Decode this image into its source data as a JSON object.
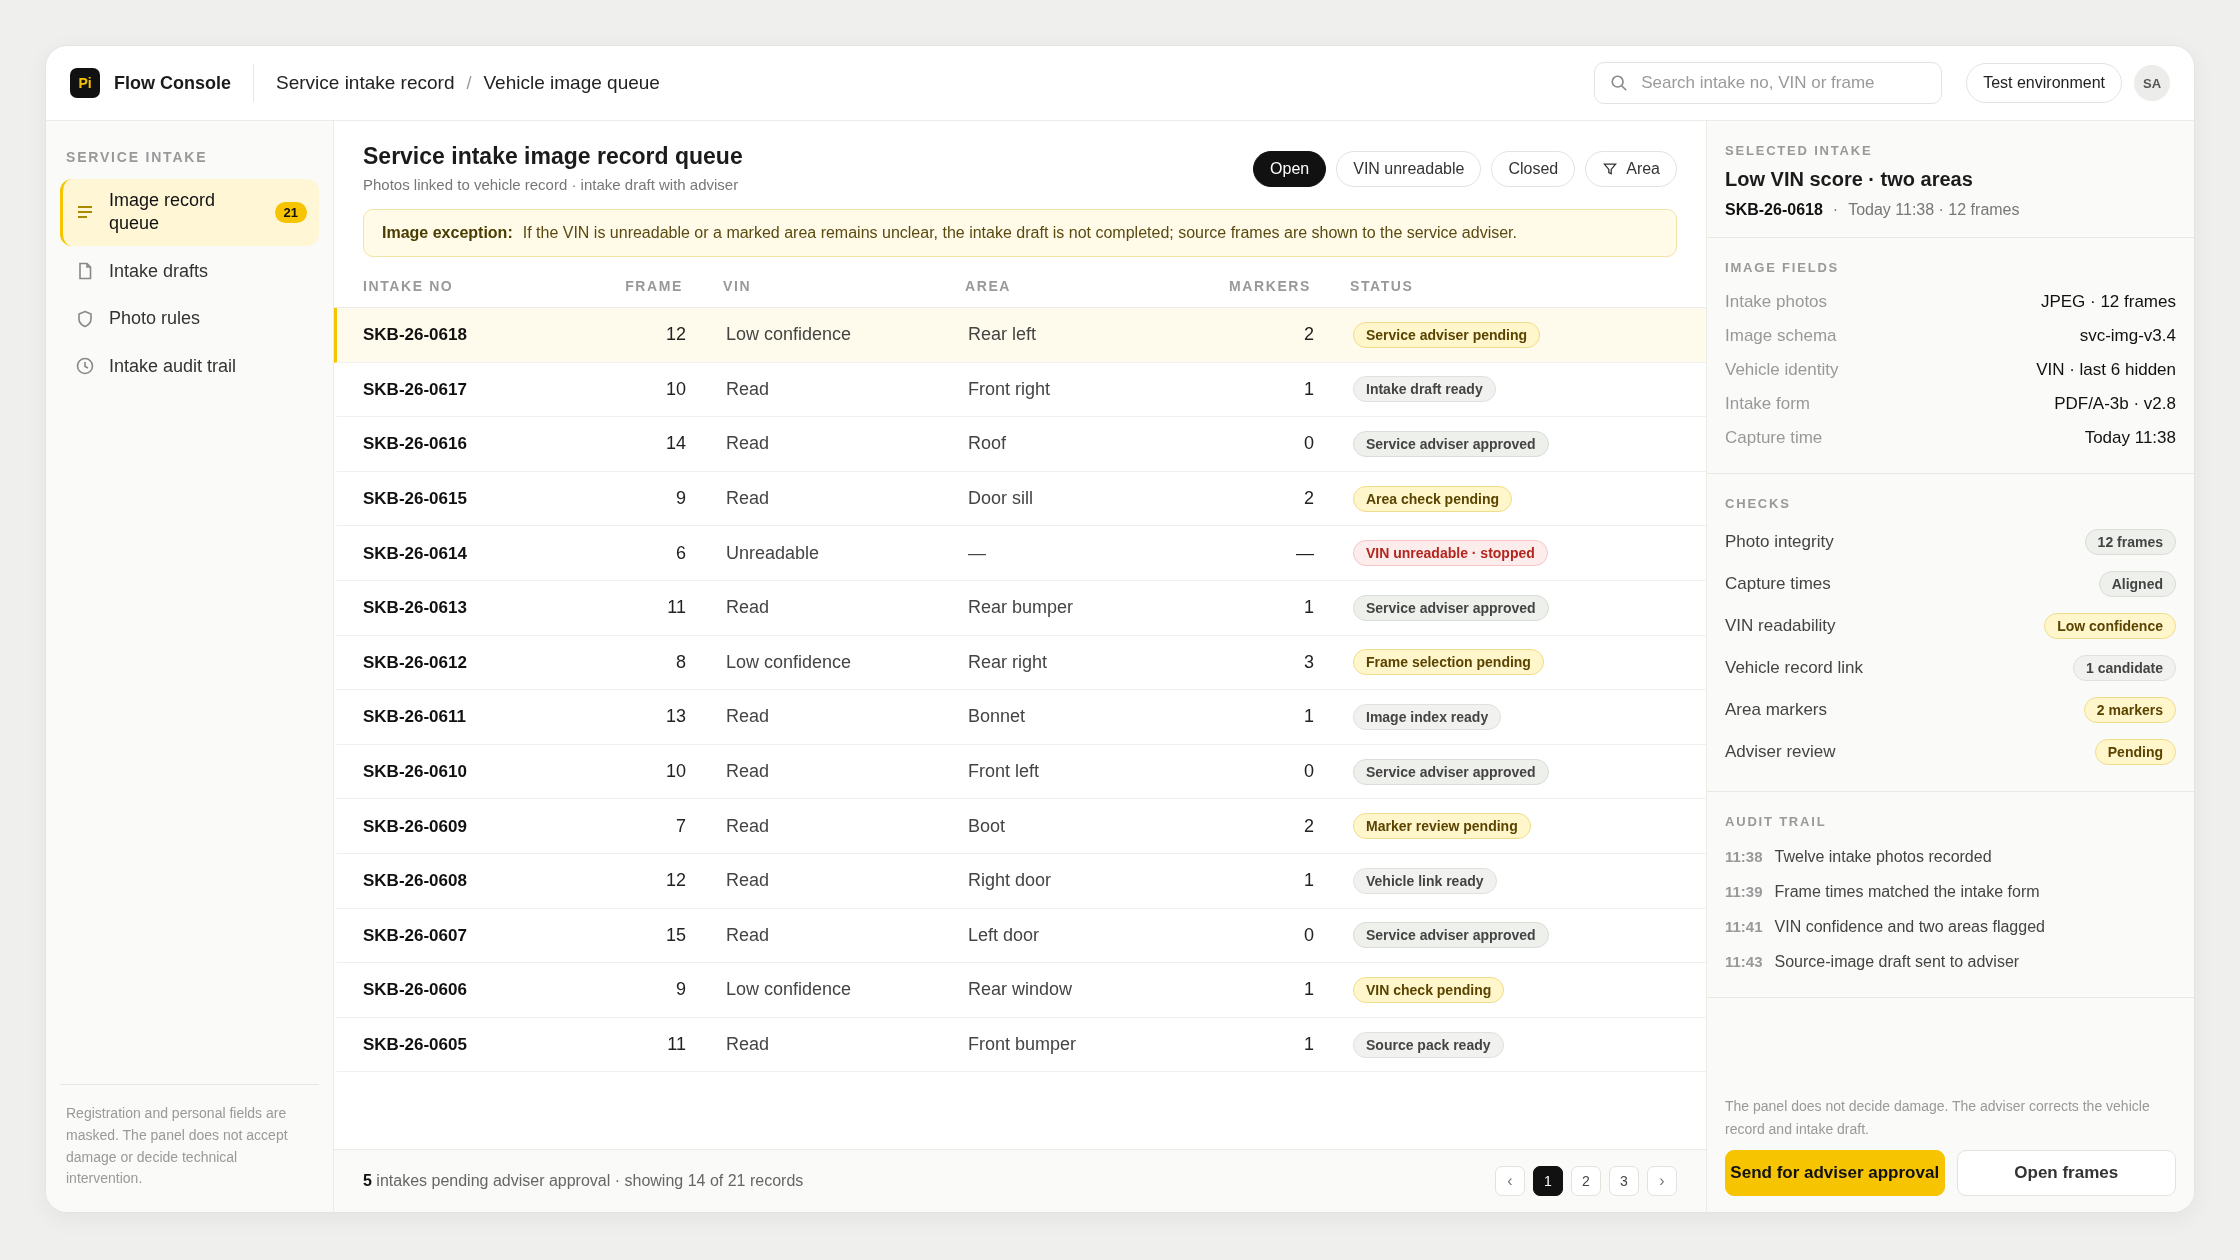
{
  "app": {
    "logo": "Pi",
    "name": "Flow Console"
  },
  "breadcrumb": [
    "Service intake record",
    "Vehicle image queue"
  ],
  "breadcrumb_separator": "/",
  "search": {
    "placeholder": "Search intake no, VIN or frame"
  },
  "environment": "Test environment",
  "avatar": "SA",
  "sidebar": {
    "heading": "SERVICE INTAKE",
    "items": [
      {
        "label": "Image record queue",
        "kind": "list",
        "badge": "21",
        "selected": true
      },
      {
        "label": "Intake drafts",
        "kind": "file",
        "selected": false
      },
      {
        "label": "Photo rules",
        "kind": "shield",
        "selected": false
      },
      {
        "label": "Intake audit trail",
        "kind": "clock",
        "selected": false
      }
    ],
    "note": "Registration and personal fields are masked. The panel does not accept damage or decide technical intervention."
  },
  "main": {
    "title": "Service intake image record queue",
    "subtitle": "Photos linked to vehicle record · intake draft with adviser",
    "filters": [
      {
        "label": "Open",
        "selected": true
      },
      {
        "label": "VIN unreadable",
        "selected": false
      },
      {
        "label": "Closed",
        "selected": false
      },
      {
        "label": "Area",
        "kind": "filter",
        "selected": false
      }
    ],
    "notice": {
      "label": "Image exception:",
      "text": "If the VIN is unreadable or a marked area remains unclear, the intake draft is not completed; source frames are shown to the service adviser."
    }
  },
  "table": {
    "columns": [
      "INTAKE NO",
      "FRAME",
      "VIN",
      "AREA",
      "MARKERS",
      "STATUS"
    ],
    "rows": [
      {
        "intake_no": "SKB-26-0618",
        "frame": "12",
        "vin": "Low confidence",
        "area": "Rear left",
        "markers": "2",
        "status": "Service adviser pending",
        "kind": "warning",
        "selected": true
      },
      {
        "intake_no": "SKB-26-0617",
        "frame": "10",
        "vin": "Read",
        "area": "Front right",
        "markers": "1",
        "status": "Intake draft ready",
        "kind": "neutral",
        "selected": false
      },
      {
        "intake_no": "SKB-26-0616",
        "frame": "14",
        "vin": "Read",
        "area": "Roof",
        "markers": "0",
        "status": "Service adviser approved",
        "kind": "success",
        "selected": false
      },
      {
        "intake_no": "SKB-26-0615",
        "frame": "9",
        "vin": "Read",
        "area": "Door sill",
        "markers": "2",
        "status": "Area check pending",
        "kind": "warning",
        "selected": false
      },
      {
        "intake_no": "SKB-26-0614",
        "frame": "6",
        "vin": "Unreadable",
        "area": "—",
        "markers": "—",
        "status": "VIN unreadable · stopped",
        "kind": "danger",
        "selected": false
      },
      {
        "intake_no": "SKB-26-0613",
        "frame": "11",
        "vin": "Read",
        "area": "Rear bumper",
        "markers": "1",
        "status": "Service adviser approved",
        "kind": "success",
        "selected": false
      },
      {
        "intake_no": "SKB-26-0612",
        "frame": "8",
        "vin": "Low confidence",
        "area": "Rear right",
        "markers": "3",
        "status": "Frame selection pending",
        "kind": "warning",
        "selected": false
      },
      {
        "intake_no": "SKB-26-0611",
        "frame": "13",
        "vin": "Read",
        "area": "Bonnet",
        "markers": "1",
        "status": "Image index ready",
        "kind": "neutral",
        "selected": false
      },
      {
        "intake_no": "SKB-26-0610",
        "frame": "10",
        "vin": "Read",
        "area": "Front left",
        "markers": "0",
        "status": "Service adviser approved",
        "kind": "success",
        "selected": false
      },
      {
        "intake_no": "SKB-26-0609",
        "frame": "7",
        "vin": "Read",
        "area": "Boot",
        "markers": "2",
        "status": "Marker review pending",
        "kind": "warning",
        "selected": false
      },
      {
        "intake_no": "SKB-26-0608",
        "frame": "12",
        "vin": "Read",
        "area": "Right door",
        "markers": "1",
        "status": "Vehicle link ready",
        "kind": "neutral",
        "selected": false
      },
      {
        "intake_no": "SKB-26-0607",
        "frame": "15",
        "vin": "Read",
        "area": "Left door",
        "markers": "0",
        "status": "Service adviser approved",
        "kind": "success",
        "selected": false
      },
      {
        "intake_no": "SKB-26-0606",
        "frame": "9",
        "vin": "Low confidence",
        "area": "Rear window",
        "markers": "1",
        "status": "VIN check pending",
        "kind": "warning",
        "selected": false
      },
      {
        "intake_no": "SKB-26-0605",
        "frame": "11",
        "vin": "Read",
        "area": "Front bumper",
        "markers": "1",
        "status": "Source pack ready",
        "kind": "neutral",
        "selected": false
      }
    ]
  },
  "footer": {
    "summary": "**5** intakes pending adviser approval · showing 14 of 21 records",
    "pagination": [
      {
        "label": "‹",
        "kind": "arrow",
        "selected": false
      },
      {
        "label": "1",
        "kind": "page",
        "selected": true
      },
      {
        "label": "2",
        "kind": "page",
        "selected": false
      },
      {
        "label": "3",
        "kind": "page",
        "selected": false
      },
      {
        "label": "›",
        "kind": "arrow",
        "selected": false
      }
    ]
  },
  "detail": {
    "heading": "SELECTED INTAKE",
    "title": "Low VIN score · two areas",
    "intake_no": "SKB-26-0618",
    "separator": "·",
    "meta": "Today 11:38 · 12 frames",
    "fields_heading": "IMAGE FIELDS",
    "fields": [
      {
        "label": "Intake photos",
        "value": "JPEG · 12 frames"
      },
      {
        "label": "Image schema",
        "value": "svc-img-v3.4"
      },
      {
        "label": "Vehicle identity",
        "value": "VIN · last 6 hidden"
      },
      {
        "label": "Intake form",
        "value": "PDF/A-3b · v2.8"
      },
      {
        "label": "Capture time",
        "value": "Today 11:38"
      }
    ],
    "checks_heading": "CHECKS",
    "checks": [
      {
        "label": "Photo integrity",
        "value": "12 frames",
        "kind": "success"
      },
      {
        "label": "Capture times",
        "value": "Aligned",
        "kind": "success"
      },
      {
        "label": "VIN readability",
        "value": "Low confidence",
        "kind": "warning"
      },
      {
        "label": "Vehicle record link",
        "value": "1 candidate",
        "kind": "neutral"
      },
      {
        "label": "Area markers",
        "value": "2 markers",
        "kind": "warning"
      },
      {
        "label": "Adviser review",
        "value": "Pending",
        "kind": "warning"
      }
    ],
    "audit_heading": "AUDIT TRAIL",
    "audit": [
      {
        "time": "11:38",
        "text": "Twelve intake photos recorded"
      },
      {
        "time": "11:39",
        "text": "Frame times matched the intake form"
      },
      {
        "time": "11:41",
        "text": "VIN confidence and two areas flagged"
      },
      {
        "time": "11:43",
        "text": "Source-image draft sent to adviser"
      }
    ],
    "note": "The panel does not decide damage. The adviser corrects the vehicle record and intake draft.",
    "actions": [
      {
        "label": "Send for adviser approval",
        "kind": "primary"
      },
      {
        "label": "Open frames",
        "kind": "secondary"
      }
    ]
  }
}
